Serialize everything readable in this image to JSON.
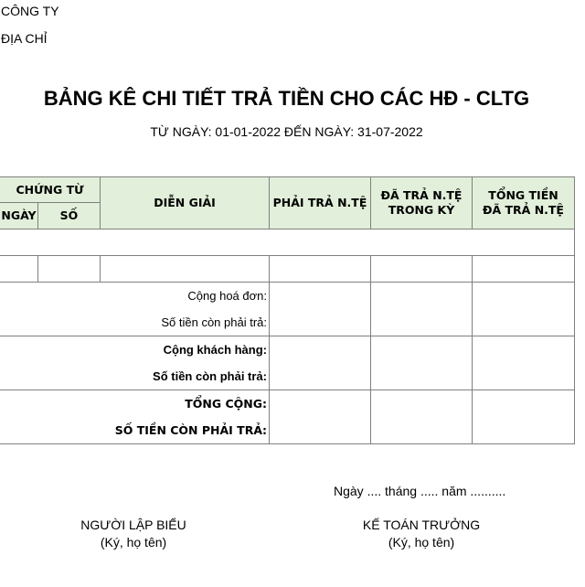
{
  "header": {
    "company_label": "CÔNG TY",
    "address_label": "ĐỊA CHỈ"
  },
  "report": {
    "title": "BẢNG KÊ CHI TIẾT TRẢ TIỀN CHO CÁC HĐ - CLTG",
    "date_range": "TỪ NGÀY: 01-01-2022 ĐẾN NGÀY: 31-07-2022"
  },
  "table": {
    "columns": {
      "voucher_group": "CHỨNG TỪ",
      "date": "NGÀY",
      "number": "SỐ",
      "description": "DIỄN GIẢI",
      "payable_fc": "PHẢI TRẢ N.TỆ",
      "paid_fc_period": "ĐÃ TRẢ N.TỆ TRONG KỲ",
      "total_paid_fc": "TỔNG TIỀN ĐÃ TRẢ N.TỆ"
    },
    "rows": [
      {
        "date": "",
        "number": "",
        "description": "",
        "payable_fc": "",
        "paid_fc_period": "",
        "total_paid_fc": ""
      }
    ],
    "summaries": {
      "invoice_total": "Cộng hoá đơn:",
      "invoice_remaining": "Số tiền còn phải trả:",
      "customer_total": "Cộng khách hàng:",
      "customer_remaining": "Số tiền còn phải trả:",
      "grand_total": "TỔNG CỘNG:",
      "grand_remaining": "SỐ TIỀN CÒN PHẢI TRẢ:"
    }
  },
  "footer": {
    "date_line": "Ngày .... tháng ..... năm ..........",
    "preparer_title": "NGƯỜI LẬP BIỂU",
    "preparer_note": "(Ký, họ tên)",
    "accountant_title": "KẾ TOÁN TRƯỞNG",
    "accountant_note": "(Ký, họ tên)"
  },
  "colors": {
    "header_bg": "#e2efda",
    "border": "#808080"
  }
}
